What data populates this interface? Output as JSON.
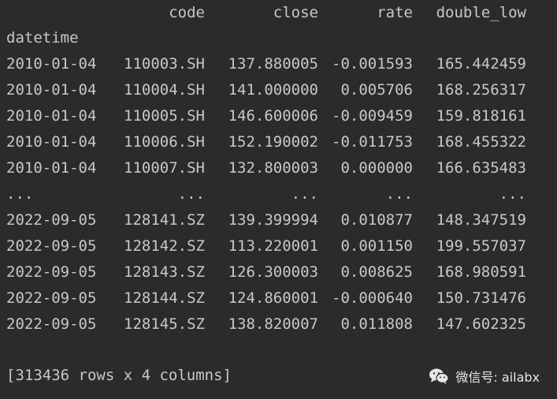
{
  "table": {
    "columns": [
      "code",
      "close",
      "rate",
      "double_low"
    ],
    "index_name": "datetime",
    "rows": [
      {
        "datetime": "2010-01-04",
        "code": "110003.SH",
        "close": "137.880005",
        "rate": "-0.001593",
        "double_low": "165.442459"
      },
      {
        "datetime": "2010-01-04",
        "code": "110004.SH",
        "close": "141.000000",
        "rate": "0.005706",
        "double_low": "168.256317"
      },
      {
        "datetime": "2010-01-04",
        "code": "110005.SH",
        "close": "146.600006",
        "rate": "-0.009459",
        "double_low": "159.818161"
      },
      {
        "datetime": "2010-01-04",
        "code": "110006.SH",
        "close": "152.190002",
        "rate": "-0.011753",
        "double_low": "168.455322"
      },
      {
        "datetime": "2010-01-04",
        "code": "110007.SH",
        "close": "132.800003",
        "rate": "0.000000",
        "double_low": "166.635483"
      },
      {
        "datetime": "...",
        "code": "...",
        "close": "...",
        "rate": "...",
        "double_low": "..."
      },
      {
        "datetime": "2022-09-05",
        "code": "128141.SZ",
        "close": "139.399994",
        "rate": "0.010877",
        "double_low": "148.347519"
      },
      {
        "datetime": "2022-09-05",
        "code": "128142.SZ",
        "close": "113.220001",
        "rate": "0.001150",
        "double_low": "199.557037"
      },
      {
        "datetime": "2022-09-05",
        "code": "128143.SZ",
        "close": "126.300003",
        "rate": "0.008625",
        "double_low": "168.980591"
      },
      {
        "datetime": "2022-09-05",
        "code": "128144.SZ",
        "close": "124.860001",
        "rate": "-0.000640",
        "double_low": "150.731476"
      },
      {
        "datetime": "2022-09-05",
        "code": "128145.SZ",
        "close": "138.820007",
        "rate": "0.011808",
        "double_low": "147.602325"
      }
    ]
  },
  "summary": "[313436 rows x 4 columns]",
  "watermark": {
    "text": "微信号: ailabx",
    "icon": "wechat-icon"
  }
}
